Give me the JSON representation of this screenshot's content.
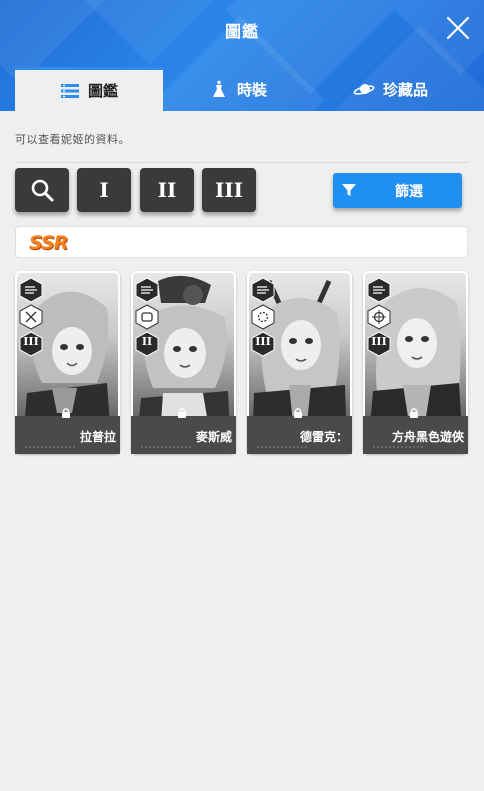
{
  "header": {
    "title": "圖鑑",
    "close_icon": "close-icon"
  },
  "tabs": [
    {
      "label": "圖鑑",
      "icon": "list-icon",
      "active": true
    },
    {
      "label": "時裝",
      "icon": "dress-icon",
      "active": false
    },
    {
      "label": "珍藏品",
      "icon": "saturn-icon",
      "active": false
    }
  ],
  "subtitle": "可以查看妮姬的資料。",
  "filters": {
    "search_icon": "search-icon",
    "burst_1": "I",
    "burst_2": "II",
    "burst_3": "III",
    "sort_label": "篩選",
    "sort_icon": "filter-icon"
  },
  "rarity": "SSR",
  "cards": [
    {
      "name": "拉普拉",
      "burst": "III"
    },
    {
      "name": "麥斯威",
      "burst": "II"
    },
    {
      "name": "德雷克：",
      "burst": "III"
    },
    {
      "name": "方舟黑色遊俠",
      "burst": "III"
    }
  ]
}
